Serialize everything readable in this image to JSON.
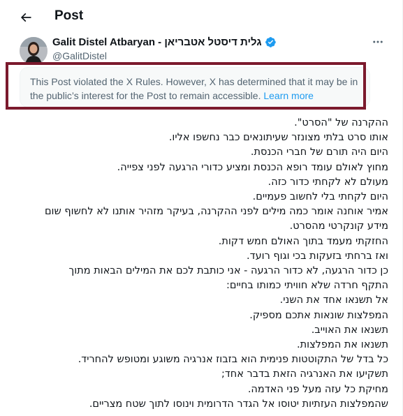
{
  "header": {
    "title": "Post"
  },
  "author": {
    "name": "Galit Distel Atbaryan - גלית דיסטל אטבריאן",
    "handle": "@GalitDistel"
  },
  "notice": {
    "text": "This Post violated the X Rules. However, X has determined that it may be in the public’s interest for the Post to remain accessible.",
    "link": "Learn more"
  },
  "post": {
    "lines": [
      "ההקרנה של \"הסרט\".",
      "אותו סרט בלתי מצונזר שעיתונאים כבר נחשפו אליו.",
      "היום היה תורם של חברי הכנסת.",
      "מחוץ לאולם עומד רופא הכנסת ומציע כדורי הרגעה לפני צפייה.",
      "מעולם לא לקחתי כדור כזה.",
      "היום לקחתי בלי לחשוב פעמיים.",
      "אמיר אוחנה אומר כמה מילים לפני ההקרנה, בעיקר מזהיר אותנו לא לחשוף שום",
      "מידע קונקרטי מהסרט.",
      "החזקתי מעמד בתוך האולם  חמש דקות.",
      "ואז ברחתי בזעקות בכי וגוף רועד.",
      "כן כדור הרגעה, לא כדור הרגעה - אני כותבת לכם את המילים הבאות מתוך",
      "התקף חרדה שלא חוויתי כמותו בחיים:",
      "אל תשנאו אחד את השני.",
      "המפלצות שונאות אתכם מספיק.",
      "תשנאו את האוייב.",
      "תשנאו את המפלצות.",
      "כל בדל של התקוטטות פנימית הוא בזבוז אנרגיה משוגע ומטופש להחריד.",
      "תשקיעו את האנרגיה הזאת בדבר אחד;",
      "מחיקת כל עזה מעל פני האדמה.",
      "שהמפלצות העזתיות יטוסו אל הגדר הדרומית וינוסו לתוך שטח מצריים."
    ]
  },
  "colors": {
    "accent": "#1d9bf0",
    "highlight_border": "#7b1a2d",
    "muted": "#536471"
  },
  "icons": {
    "back": "arrow-left-icon",
    "verified": "verified-badge-icon",
    "more": "more-horizontal-icon"
  }
}
